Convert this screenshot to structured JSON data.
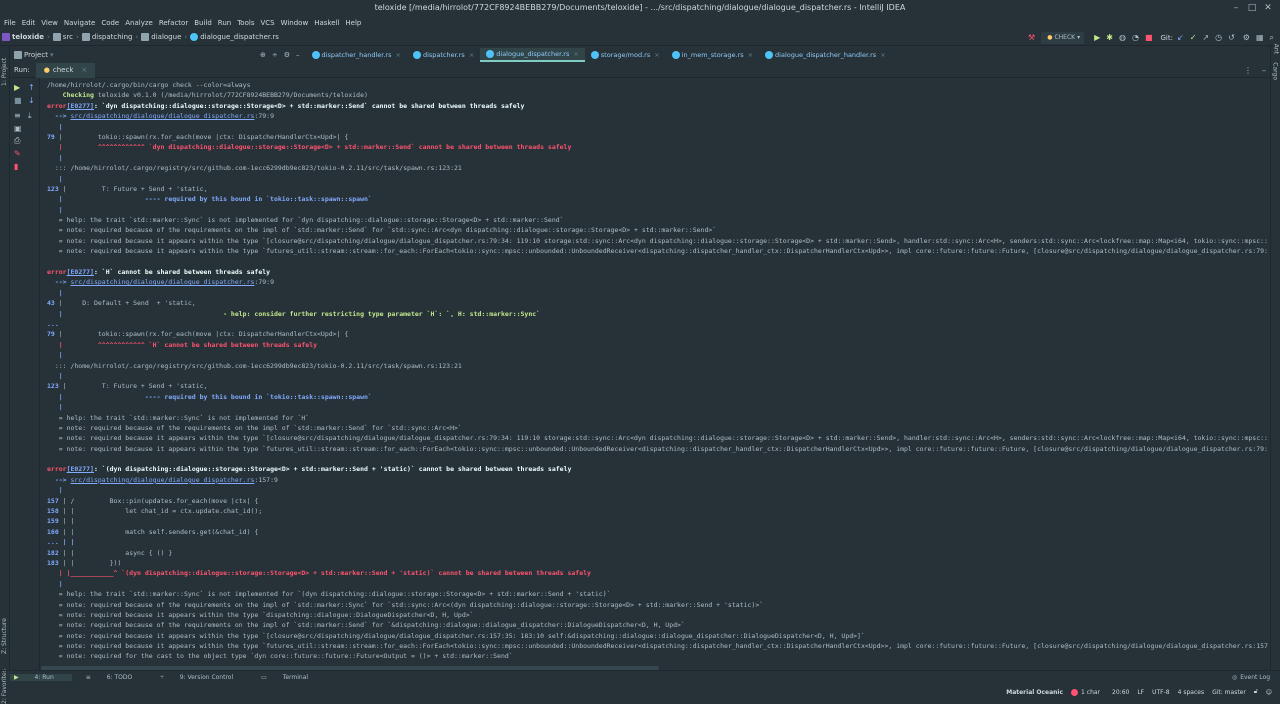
{
  "window": {
    "title": "teloxide [/media/hirrolot/772CF8924BEBB279/Documents/teloxide] - .../src/dispatching/dialogue/dialogue_dispatcher.rs - IntelliJ IDEA"
  },
  "menu": [
    "File",
    "Edit",
    "View",
    "Navigate",
    "Code",
    "Analyze",
    "Refactor",
    "Build",
    "Run",
    "Tools",
    "VCS",
    "Window",
    "Haskell",
    "Help"
  ],
  "breadcrumbs": [
    "teloxide",
    "src",
    "dispatching",
    "dialogue",
    "dialogue_dispatcher.rs"
  ],
  "toolbar": {
    "run_config": "CHECK",
    "git_label": "Git:"
  },
  "left_strip": {
    "project": "1: Project",
    "structure": "Z: Structure",
    "favorites": "2: Favorites"
  },
  "right_strip": {
    "ant": "Ant",
    "cargo": "Cargo"
  },
  "project_panel": {
    "label": "Project"
  },
  "editor_tabs": [
    {
      "label": "dispatcher_handler.rs",
      "active": false
    },
    {
      "label": "dispatcher.rs",
      "active": false
    },
    {
      "label": "dialogue_dispatcher.rs",
      "active": true
    },
    {
      "label": "storage/mod.rs",
      "active": false
    },
    {
      "label": "in_mem_storage.rs",
      "active": false
    },
    {
      "label": "dialogue_dispatcher_handler.rs",
      "active": false
    }
  ],
  "run_panel": {
    "label": "Run:",
    "tab": "check"
  },
  "console": {
    "l1": "/home/hirrolot/.cargo/bin/cargo check --color=always",
    "l2a": "    Checking",
    "l2b": " teloxide v0.1.0 (/media/hirrolot/772CF8924BEBB279/Documents/teloxide)",
    "e1_head": "error",
    "e1_code": "[E0277]",
    "e1_msg": ": `dyn dispatching::dialogue::storage::Storage<D> + std::marker::Send` cannot be shared between threads safely",
    "arrow": "  --> ",
    "e1_path": "src/dispatching/dialogue/dialogue_dispatcher.rs",
    "e1_loc": ":79:9",
    "bar": "   |",
    "l79num": "79",
    "l79text": " |         tokio::spawn(rx.for_each(move |ctx: DispatcherHandlerCtx<Upd>| {",
    "e1_caret": "   |         ^^^^^^^^^^^^ `dyn dispatching::dialogue::storage::Storage<D> + std::marker::Send` cannot be shared between threads safely",
    "spawn_path": "  ::: /home/hirrolot/.cargo/registry/src/github.com-1ecc6299db9ec823/tokio-0.2.11/src/task/spawn.rs:123:21",
    "l123num": "123",
    "l123text": " |         T: Future + Send + 'static,",
    "req_bound": "   |                     ---- required by this bound in `tokio::task::spawn::spawn`",
    "e1_help": "   = help: the trait `std::marker::Sync` is not implemented for `dyn dispatching::dialogue::storage::Storage<D> + std::marker::Send`",
    "e1_note1": "   = note: required because of the requirements on the impl of `std::marker::Send` for `std::sync::Arc<dyn dispatching::dialogue::storage::Storage<D> + std::marker::Send>`",
    "e1_note2": "   = note: required because it appears within the type `[closure@src/dispatching/dialogue/dialogue_dispatcher.rs:79:34: 119:10 storage:std::sync::Arc<dyn dispatching::dialogue::storage::Storage<D> + std::marker::Send>, handler:std::sync::Arc<H>, senders:std::sync::Arc<lockfree::map::Map<i64, tokio::sync::mpsc::unbounded::UnboundedSender<DialogueDispatcherHandlerCtx<Upd, D>>>>]`",
    "e1_note3": "   = note: required because it appears within the type `futures_util::stream::stream::for_each::ForEach<tokio::sync::mpsc::unbounded::UnboundedReceiver<dispatching::dispatcher_handler_ctx::DispatcherHandlerCtx<Upd>>, impl core::future::future::Future, [closure@src/dispatching/dialogue/dialogue_dispatcher.rs:79:34: 119:10]>`",
    "e2_msg": ": `H` cannot be shared between threads safely",
    "e2_path": "src/dispatching/dialogue/dialogue_dispatcher.rs",
    "e2_loc": ":79:9",
    "l43num": "43",
    "l43text": " |     D: Default + Send  + 'static,",
    "e2_help_pre": "   |                                         ",
    "e2_help": "- help: consider further restricting type parameter `H`: `, H: std::marker::Sync`",
    "dots": "...",
    "e2_caret": "   |         ^^^^^^^^^^^^ `H` cannot be shared between threads safely",
    "e2_help2": "   = help: the trait `std::marker::Sync` is not implemented for `H`",
    "e2_note1": "   = note: required because of the requirements on the impl of `std::marker::Send` for `std::sync::Arc<H>`",
    "e2_note2": "   = note: required because it appears within the type `[closure@src/dispatching/dialogue/dialogue_dispatcher.rs:79:34: 119:10 storage:std::sync::Arc<dyn dispatching::dialogue::storage::Storage<D> + std::marker::Send>, handler:std::sync::Arc<H>, senders:std::sync::Arc<lockfree::map::Map<i64, tokio::sync::mpsc::unbounded::UnboundedSender<DialogueDispatcherHandlerCtx<Upd, D>>>>]`",
    "e2_note3": "   = note: required because it appears within the type `futures_util::stream::stream::for_each::ForEach<tokio::sync::mpsc::unbounded::UnboundedReceiver<dispatching::dispatcher_handler_ctx::DispatcherHandlerCtx<Upd>>, impl core::future::future::Future, [closure@src/dispatching/dialogue/dialogue_dispatcher.rs:79:34: 119:10]>`",
    "e3_msg": ": `(dyn dispatching::dialogue::storage::Storage<D> + std::marker::Send + 'static)` cannot be shared between threads safely",
    "e3_path": "src/dispatching/dialogue/dialogue_dispatcher.rs",
    "e3_loc": ":157:9",
    "l157num": "157",
    "l157text": " | /         Box::pin(updates.for_each(move |ctx| {",
    "l158num": "158",
    "l158text": " | |             let chat_id = ctx.update.chat_id();",
    "l159num": "159",
    "l159text": " | |",
    "l160num": "160",
    "l160text": " | |             match self.senders.get(&chat_id) {",
    "dots2": "... | |",
    "l182num": "182",
    "l182text": " | |             async { () }",
    "l183num": "183",
    "l183text": " | |         }))",
    "e3_caret": "   | |___________^ `(dyn dispatching::dialogue::storage::Storage<D> + std::marker::Send + 'static)` cannot be shared between threads safely",
    "e3_help": "   = help: the trait `std::marker::Sync` is not implemented for `(dyn dispatching::dialogue::storage::Storage<D> + std::marker::Send + 'static)`",
    "e3_note1": "   = note: required because of the requirements on the impl of `std::marker::Sync` for `std::sync::Arc<(dyn dispatching::dialogue::storage::Storage<D> + std::marker::Send + 'static)>`",
    "e3_note2": "   = note: required because it appears within the type `dispatching::dialogue::DialogueDispatcher<D, H, Upd>`",
    "e3_note3": "   = note: required because of the requirements on the impl of `std::marker::Send` for `&dispatching::dialogue::dialogue_dispatcher::DialogueDispatcher<D, H, Upd>`",
    "e3_note4": "   = note: required because it appears within the type `[closure@src/dispatching/dialogue/dialogue_dispatcher.rs:157:35: 183:10 self:&dispatching::dialogue::dialogue_dispatcher::DialogueDispatcher<D, H, Upd>]`",
    "e3_note5": "   = note: required because it appears within the type `futures_util::stream::stream::for_each::ForEach<tokio::sync::mpsc::unbounded::UnboundedReceiver<dispatching::dispatcher_handler_ctx::DispatcherHandlerCtx<Upd>>, impl core::future::future::Future, [closure@src/dispatching/dialogue/dialogue_dispatcher.rs:157:35: 183:10 self:&dispatching::dialogue::dialogue_dispatcher::DialogueDispatcher<D, H, Upd>]>`",
    "e3_note6": "   = note: required for the cast to the object type `dyn core::future::future::Future<Output = ()> + std::marker::Send`"
  },
  "bottom_tabs": [
    "4: Run",
    "6: TODO",
    "9: Version Control",
    "Terminal"
  ],
  "event_log": "Event Log",
  "status": {
    "theme": "Material Oceanic",
    "chars": "1 char",
    "pos": "20:60",
    "lf": "LF",
    "enc": "UTF-8",
    "indent": "4 spaces",
    "git": "Git: master"
  }
}
